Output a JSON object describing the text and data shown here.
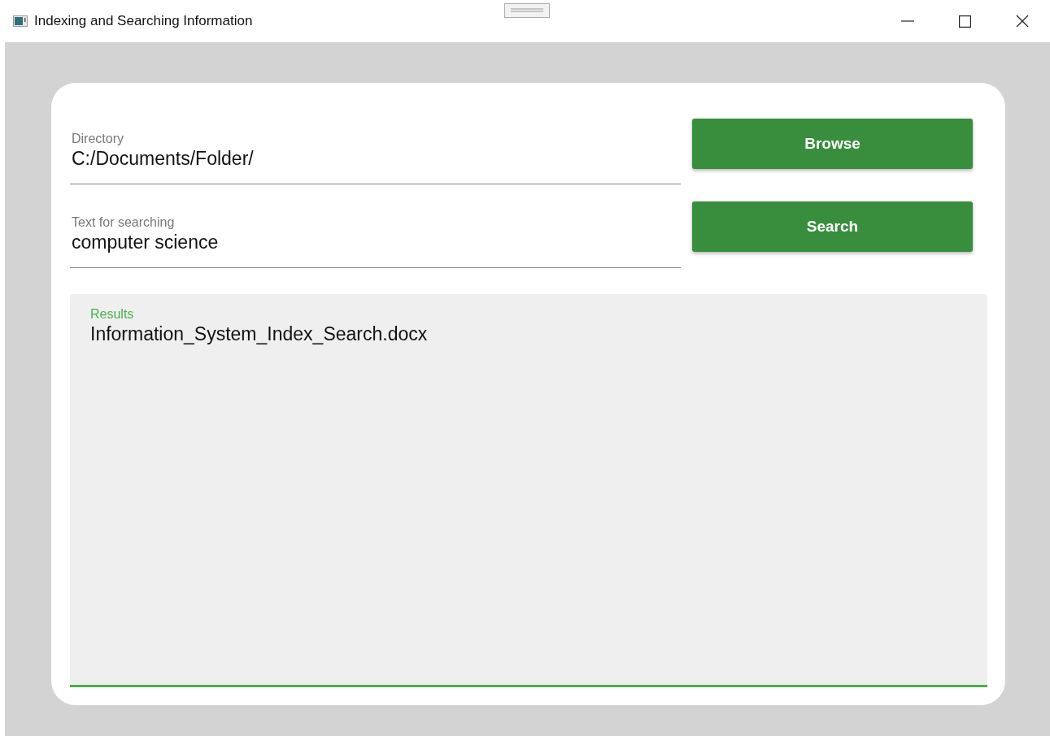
{
  "window": {
    "title": "Indexing and Searching Information"
  },
  "fields": [
    {
      "label": "Directory",
      "value": "C:/Documents/Folder/"
    },
    {
      "label": "Text for searching",
      "value": "computer science"
    }
  ],
  "buttons": [
    "Browse",
    "Search"
  ],
  "results": {
    "label": "Results",
    "focused": true,
    "items": [
      "Information_System_Index_Search.docx"
    ]
  }
}
